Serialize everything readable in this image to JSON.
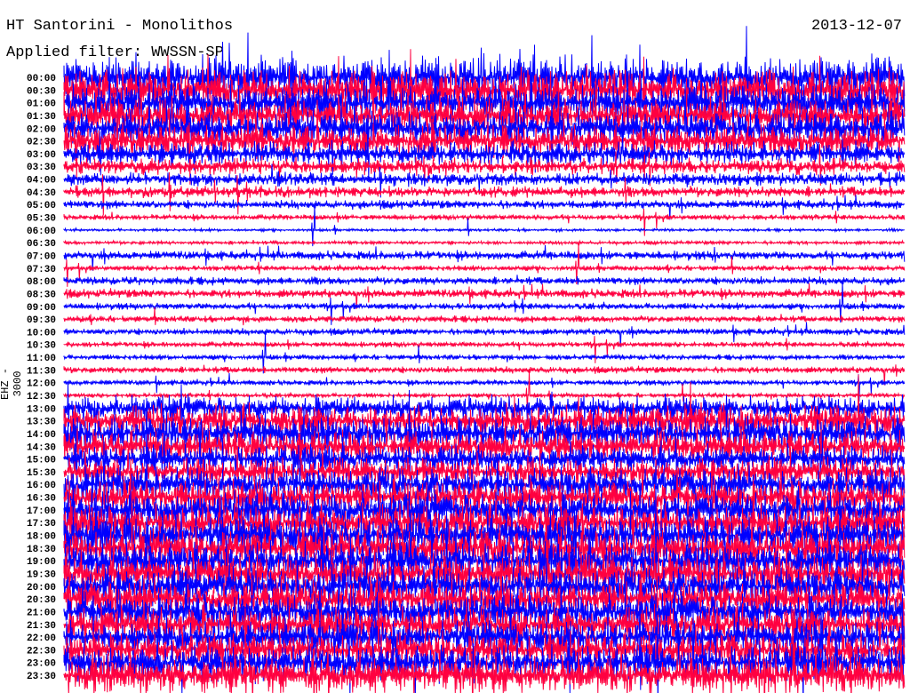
{
  "header": {
    "title": "HT Santorini - Monolithos",
    "date": "2013-12-07",
    "filter": "Applied filter: WWSSN-SP"
  },
  "chart_data": {
    "type": "line",
    "title": "HT Santorini - Monolithos",
    "ylabel": "EHZ - 3000",
    "colors": [
      "#0000ff",
      "#ff0040"
    ],
    "row_labels": [
      "00:00",
      "00:30",
      "01:00",
      "01:30",
      "02:00",
      "02:30",
      "03:00",
      "03:30",
      "04:00",
      "04:30",
      "05:00",
      "05:30",
      "06:00",
      "06:30",
      "07:00",
      "07:30",
      "08:00",
      "08:30",
      "09:00",
      "09:30",
      "10:00",
      "10:30",
      "11:00",
      "11:30",
      "12:00",
      "12:30",
      "13:00",
      "13:30",
      "14:00",
      "14:30",
      "15:00",
      "15:30",
      "16:00",
      "16:30",
      "17:00",
      "17:30",
      "18:00",
      "18:30",
      "19:00",
      "19:30",
      "20:00",
      "20:30",
      "21:00",
      "21:30",
      "22:00",
      "22:30",
      "23:00",
      "23:30"
    ],
    "relative_activity": [
      0.9,
      0.9,
      0.85,
      0.8,
      0.8,
      0.7,
      0.5,
      0.35,
      0.3,
      0.25,
      0.2,
      0.12,
      0.06,
      0.08,
      0.2,
      0.12,
      0.18,
      0.2,
      0.15,
      0.15,
      0.15,
      0.12,
      0.12,
      0.15,
      0.12,
      0.1,
      0.55,
      0.7,
      0.75,
      0.7,
      0.6,
      0.6,
      0.7,
      0.75,
      0.8,
      0.85,
      0.85,
      0.85,
      0.85,
      0.85,
      0.8,
      0.8,
      0.8,
      0.8,
      0.75,
      0.75,
      0.8,
      0.85
    ]
  }
}
